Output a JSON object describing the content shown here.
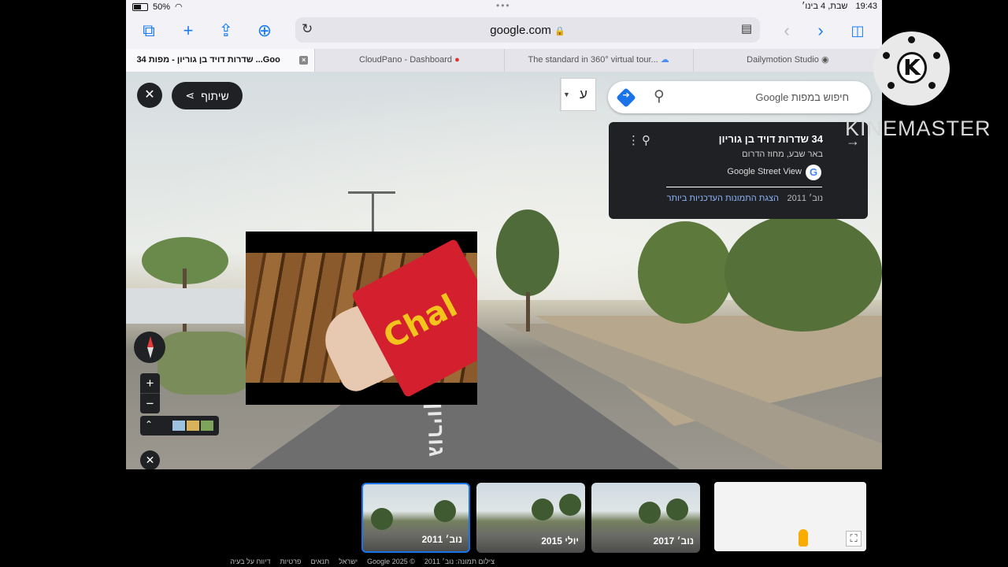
{
  "status": {
    "battery": "50%",
    "date": "שבת, 4 בינו׳",
    "time": "19:43",
    "dots": "•••"
  },
  "toolbar": {
    "url": "google.com",
    "lock": "🔒"
  },
  "tabs": [
    {
      "label": "34 שדרות דויד בן גוריון - מפות ...Goo"
    },
    {
      "label": "CloudPano - Dashboard"
    },
    {
      "label": "The standard in 360° virtual tour..."
    },
    {
      "label": "Dailymotion Studio"
    }
  ],
  "map": {
    "share_label": "שיתוף",
    "lang_letter": "ע",
    "search_placeholder": "חיפוש במפות Google",
    "card": {
      "title": "34 שדרות דויד בן גוריון",
      "subtitle": "באר שבע, מחוז הדרום",
      "source": "Google Street View",
      "date": "נוב׳ 2011",
      "latest_link": "הצגת התמונות העדכניות ביותר"
    },
    "road_text": "גוריון"
  },
  "video": {
    "wrapper_text": "Chal"
  },
  "timeline": [
    {
      "label": "נוב׳ 2011",
      "active": true
    },
    {
      "label": "יולי 2015",
      "active": false
    },
    {
      "label": "נוב׳ 2017",
      "active": false
    }
  ],
  "footer": {
    "capture": "צילום תמונה: נוב׳ 2011",
    "copyright": "© 2025 Google",
    "country": "ישראל",
    "terms": "תנאים",
    "privacy": "פרטיות",
    "report": "דיווח על בעיה"
  },
  "watermark": {
    "logo_letter": "K",
    "text": "KINEMASTER"
  }
}
